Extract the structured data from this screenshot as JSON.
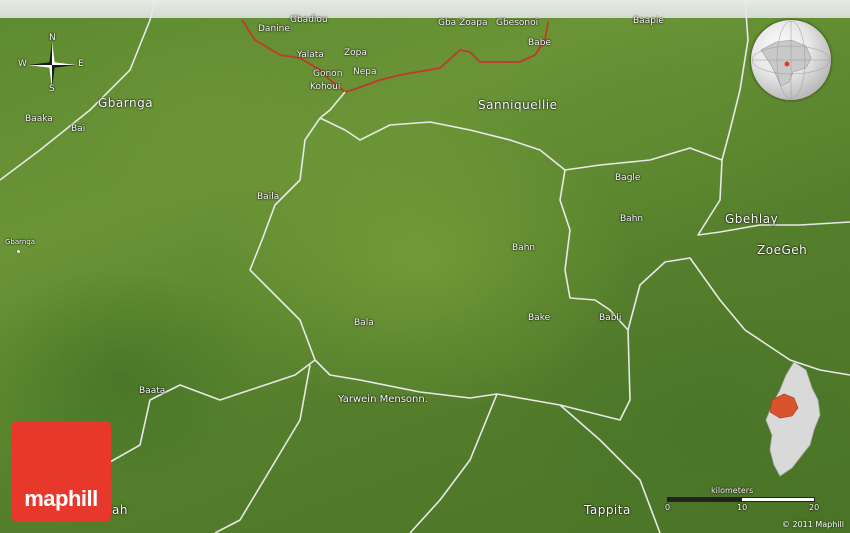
{
  "map": {
    "compass": {
      "n": "N",
      "s": "S",
      "w": "W",
      "e": "E"
    },
    "places": [
      {
        "id": "danine",
        "text": "Danine"
      },
      {
        "id": "gbadiou",
        "text": "Gbadiou"
      },
      {
        "id": "gbazoapa",
        "text": "Gba Zoapa"
      },
      {
        "id": "gbesonoi",
        "text": "Gbesonoi"
      },
      {
        "id": "baapie",
        "text": "Baapie"
      },
      {
        "id": "babe",
        "text": "Babe"
      },
      {
        "id": "yalata",
        "text": "Yalata"
      },
      {
        "id": "zopa",
        "text": "Zopa"
      },
      {
        "id": "gonon",
        "text": "Gonon"
      },
      {
        "id": "nepa",
        "text": "Nepa"
      },
      {
        "id": "kohoui",
        "text": "Kohoui"
      },
      {
        "id": "gbarnga_region",
        "text": "Gbarnga"
      },
      {
        "id": "sanniquellie",
        "text": "Sanniquellie"
      },
      {
        "id": "baaka",
        "text": "Baaka"
      },
      {
        "id": "bai",
        "text": "Bai"
      },
      {
        "id": "baila",
        "text": "Baila"
      },
      {
        "id": "gbarnga_town",
        "text": "Gbarnga"
      },
      {
        "id": "bagle",
        "text": "Bagle"
      },
      {
        "id": "bahn1",
        "text": "Bahn"
      },
      {
        "id": "bahn2",
        "text": "Bahn"
      },
      {
        "id": "gbehlay",
        "text": "Gbehlay"
      },
      {
        "id": "zoegeh",
        "text": "ZoeGeh"
      },
      {
        "id": "bala",
        "text": "Bala"
      },
      {
        "id": "bake",
        "text": "Bake"
      },
      {
        "id": "babli",
        "text": "Babli"
      },
      {
        "id": "baata",
        "text": "Baata"
      },
      {
        "id": "yarwein",
        "text": "Yarwein Mensonn."
      },
      {
        "id": "tappita",
        "text": "Tappita"
      },
      {
        "id": "ah",
        "text": "ah"
      }
    ],
    "scale": {
      "title": "kilometers",
      "ticks": [
        "0",
        "10",
        "20"
      ]
    },
    "copyright": "© 2011 Maphill",
    "logo_text": "maphill",
    "colors": {
      "boundary": "#e8e8e8",
      "international_border": "#c0392b",
      "region_highlight": "#d9532c",
      "logo": "#e8382c"
    }
  }
}
